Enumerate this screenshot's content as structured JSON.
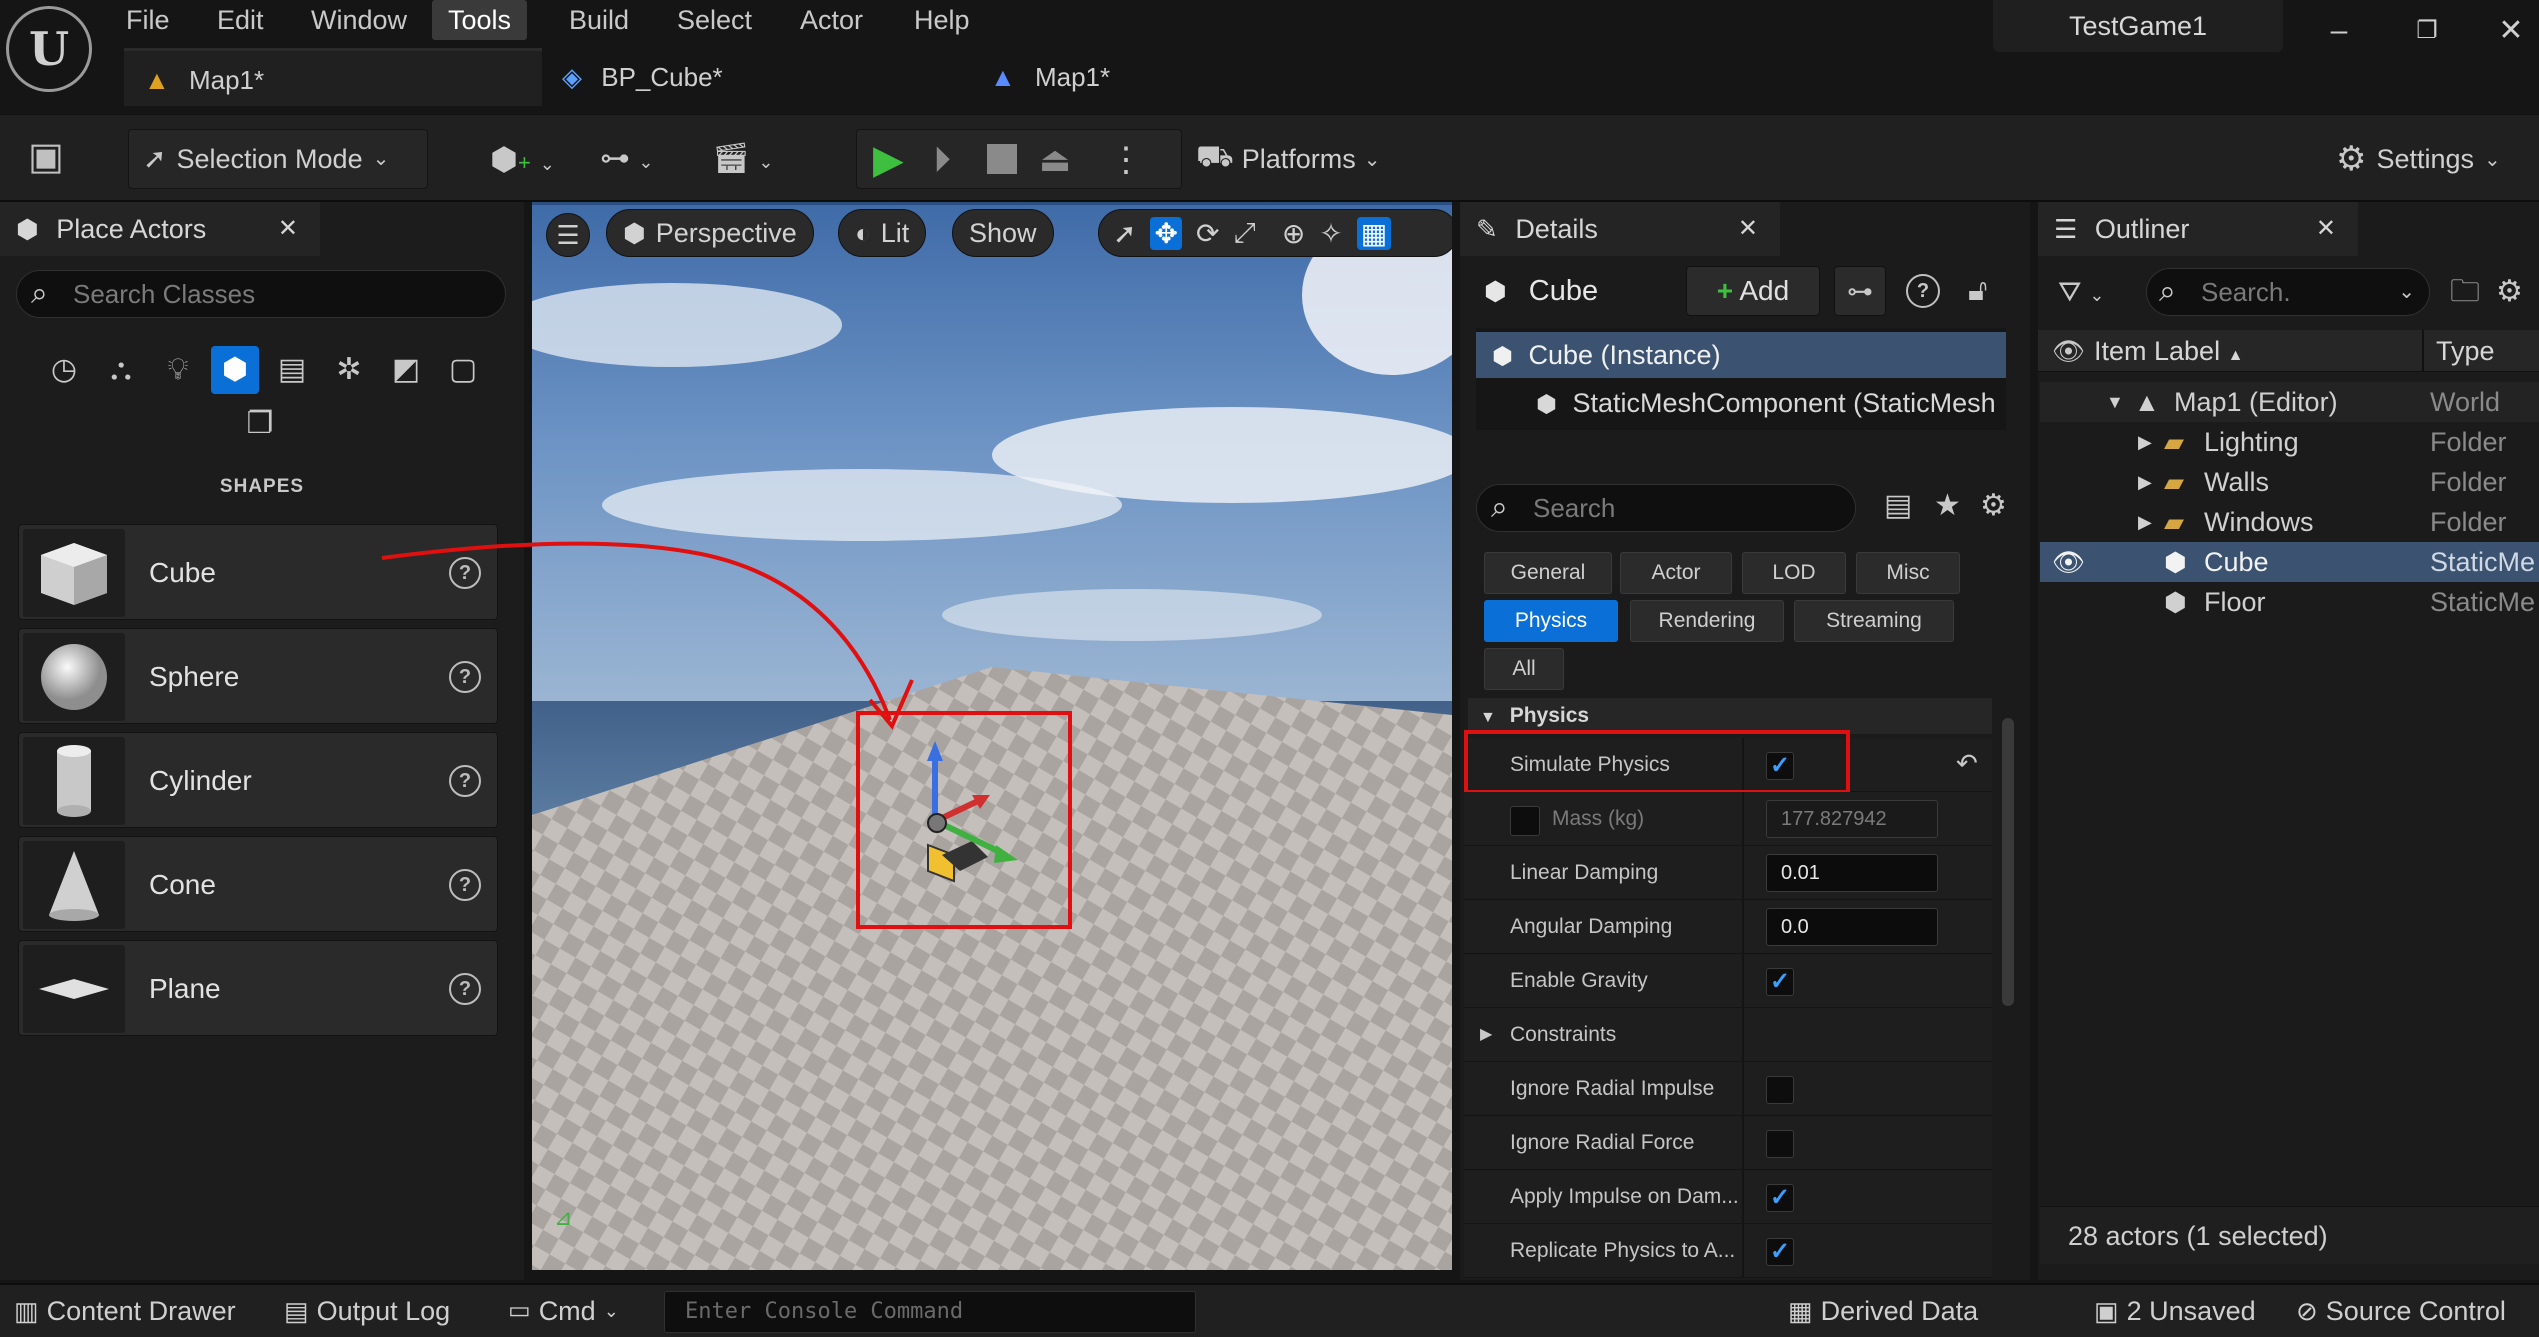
{
  "menu": [
    "File",
    "Edit",
    "Window",
    "Tools",
    "Build",
    "Select",
    "Actor",
    "Help"
  ],
  "active_menu": "Tools",
  "tabs": [
    {
      "label": "Map1*",
      "icon": "level-icon"
    },
    {
      "label": "BP_Cube*",
      "icon": "blueprint-icon"
    },
    {
      "label": "Map1*",
      "icon": "level-blueprint-icon"
    }
  ],
  "project_name": "TestGame1",
  "toolbar": {
    "selection_mode": "Selection Mode",
    "platforms": "Platforms",
    "settings": "Settings"
  },
  "place_actors": {
    "title": "Place Actors",
    "search_placeholder": "Search Classes",
    "category_title": "SHAPES",
    "items": [
      "Cube",
      "Sphere",
      "Cylinder",
      "Cone",
      "Plane"
    ]
  },
  "viewport": {
    "perspective": "Perspective",
    "lit": "Lit",
    "show": "Show"
  },
  "details": {
    "title": "Details",
    "actor_name": "Cube",
    "add_label": "Add",
    "component_root": "Cube (Instance)",
    "component_child": "StaticMeshComponent (StaticMesh",
    "search_placeholder": "Search",
    "filters_row1": [
      "General",
      "Actor",
      "LOD",
      "Misc"
    ],
    "filters_row2": [
      "Physics",
      "Rendering",
      "Streaming"
    ],
    "filters_row3": [
      "All"
    ],
    "active_filter": "Physics",
    "section": "Physics",
    "props": {
      "simulate_physics": "Simulate Physics",
      "mass": "Mass (kg)",
      "mass_value": "177.827942",
      "linear_damping": "Linear Damping",
      "linear_damping_value": "0.01",
      "angular_damping": "Angular Damping",
      "angular_damping_value": "0.0",
      "enable_gravity": "Enable Gravity",
      "constraints": "Constraints",
      "ignore_radial_impulse": "Ignore Radial Impulse",
      "ignore_radial_force": "Ignore Radial Force",
      "apply_impulse": "Apply Impulse on Dam...",
      "replicate_physics": "Replicate Physics to A..."
    },
    "checkmark": "✓"
  },
  "outliner": {
    "title": "Outliner",
    "search_placeholder": "Search.",
    "col_label": "Item Label",
    "col_type": "Type",
    "rows": [
      {
        "label": "Map1 (Editor)",
        "type": "World"
      },
      {
        "label": "Lighting",
        "type": "Folder"
      },
      {
        "label": "Walls",
        "type": "Folder"
      },
      {
        "label": "Windows",
        "type": "Folder"
      },
      {
        "label": "Cube",
        "type": "StaticMe"
      },
      {
        "label": "Floor",
        "type": "StaticMe"
      }
    ],
    "status": "28 actors (1 selected)"
  },
  "statusbar": {
    "content_drawer": "Content Drawer",
    "output_log": "Output Log",
    "cmd": "Cmd",
    "console_placeholder": "Enter Console Command",
    "derived_data": "Derived Data",
    "unsaved": "2 Unsaved",
    "source_control": "Source Control"
  },
  "colors": {
    "accent_blue": "#0a6fd6",
    "selection_blue": "#3b5270",
    "annotation_red": "#e01010",
    "play_green": "#3fbf3f"
  }
}
